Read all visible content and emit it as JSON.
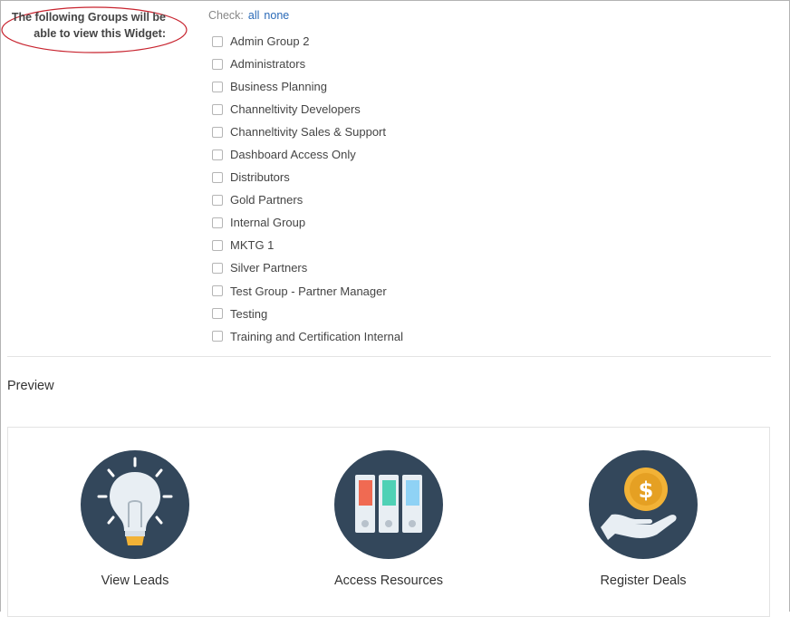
{
  "visibility": {
    "label": "The following Groups will be able to view this Widget:",
    "check_label": "Check:",
    "check_all": "all",
    "check_none": "none",
    "groups": [
      "Admin Group 2",
      "Administrators",
      "Business Planning",
      "Channeltivity Developers",
      "Channeltivity Sales & Support",
      "Dashboard Access Only",
      "Distributors",
      "Gold Partners",
      "Internal Group",
      "MKTG 1",
      "Silver Partners",
      "Test Group - Partner Manager",
      "Testing",
      "Training and Certification Internal"
    ]
  },
  "preview": {
    "title": "Preview",
    "tiles": [
      {
        "label": "View Leads",
        "icon": "lightbulb-icon"
      },
      {
        "label": "Access Resources",
        "icon": "binders-icon"
      },
      {
        "label": "Register Deals",
        "icon": "hand-coin-icon"
      }
    ]
  },
  "colors": {
    "icon_circle": "#33475b",
    "annotation": "#c8242f",
    "link": "#2a6ab7"
  }
}
